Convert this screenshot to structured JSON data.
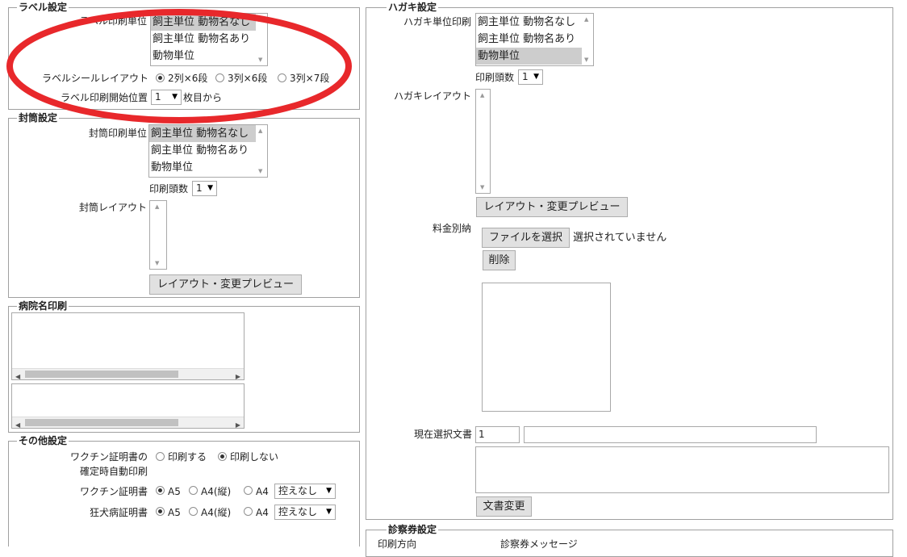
{
  "label_settings": {
    "legend": "ラベル設定",
    "print_unit_label": "ラベル印刷単位",
    "print_unit_options": [
      "飼主単位 動物名なし",
      "飼主単位 動物名あり",
      "動物単位"
    ],
    "layout_label": "ラベルシールレイアウト",
    "layout_options": [
      "2列×6段",
      "3列×6段",
      "3列×7段"
    ],
    "start_position_label": "ラベル印刷開始位置",
    "start_position_value": "1",
    "start_position_suffix": "枚目から"
  },
  "envelope_settings": {
    "legend": "封筒設定",
    "print_unit_label": "封筒印刷単位",
    "print_unit_options": [
      "飼主単位 動物名なし",
      "飼主単位 動物名あり",
      "動物単位"
    ],
    "print_count_label": "印刷頭数",
    "print_count_value": "1",
    "layout_label": "封筒レイアウト",
    "preview_button": "レイアウト・変更プレビュー"
  },
  "hospital_name": {
    "legend": "病院名印刷"
  },
  "other_settings": {
    "legend": "その他設定",
    "vaccine_auto_label_1": "ワクチン証明書の",
    "vaccine_auto_label_2": "確定時自動印刷",
    "vaccine_auto_options": [
      "印刷する",
      "印刷しない"
    ],
    "vaccine_cert_label": "ワクチン証明書",
    "rabies_cert_label": "狂犬病証明書",
    "paper_options": [
      "A5",
      "A4(縦)",
      "A4"
    ],
    "copy_select_value": "控えなし"
  },
  "postcard_settings": {
    "legend": "ハガキ設定",
    "print_unit_label": "ハガキ単位印刷",
    "print_unit_options": [
      "飼主単位 動物名なし",
      "飼主単位 動物名あり",
      "動物単位"
    ],
    "print_count_label": "印刷頭数",
    "print_count_value": "1",
    "layout_label": "ハガキレイアウト",
    "preview_button": "レイアウト・変更プレビュー",
    "postage_label": "料金別納",
    "file_button": "ファイルを選択",
    "file_status": "選択されていません",
    "delete_button": "削除",
    "current_doc_label": "現在選択文書",
    "current_doc_number": "1",
    "change_doc_button": "文書変更"
  },
  "exam_ticket": {
    "legend": "診察券設定",
    "print_direction_label": "印刷方向",
    "message_label": "診察券メッセージ"
  },
  "colors": {
    "annotation_circle": "#e8282b",
    "selected_option": "#cdcdcd"
  }
}
